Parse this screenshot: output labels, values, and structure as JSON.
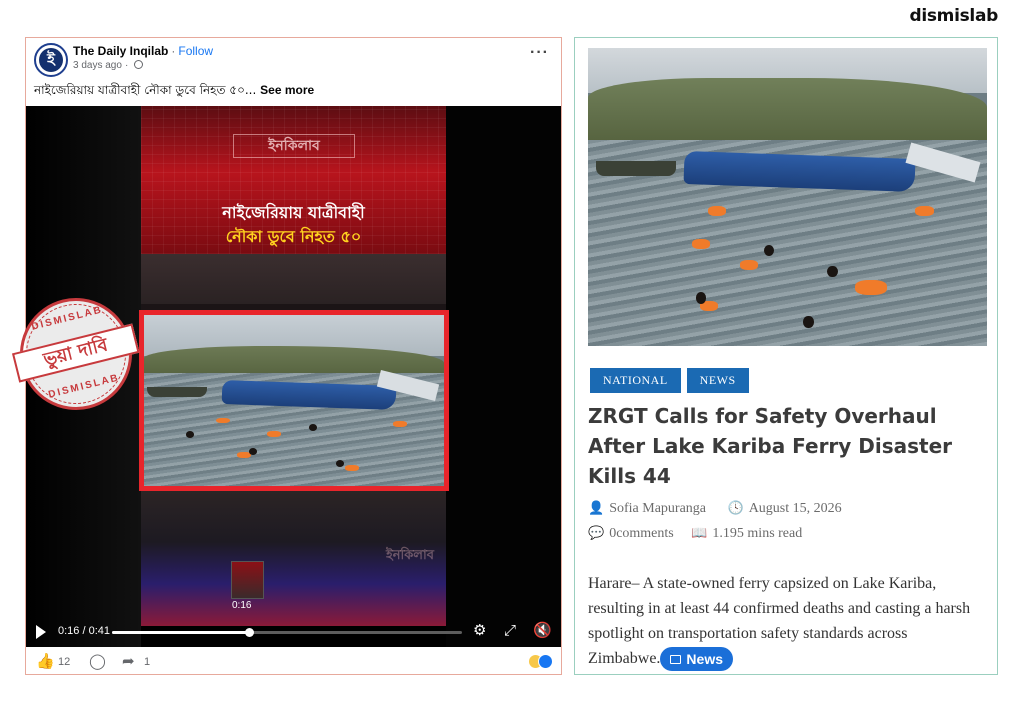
{
  "brand": "dismislab",
  "facebook_post": {
    "page_name": "The Daily Inqilab",
    "follow_label": "Follow",
    "time_ago": "3 days ago",
    "caption": "নাইজেরিয়ায় যাত্রীবাহী নৌকা ডুবে নিহত ৫০...",
    "see_more": "See more",
    "video": {
      "logo_text": "ইনকিলাব",
      "headline_line1": "নাইজেরিয়ায় যাত্রীবাহী",
      "headline_line2": "নৌকা ডুবে নিহত ৫০",
      "thumbnail_time": "0:16",
      "time_display": "0:16 / 0:41",
      "progress": 0.39
    },
    "likes_count": "12",
    "shares_count": "1"
  },
  "stamp": {
    "top_text": "DISMISLAB",
    "band_text": "ভুয়া দাবি",
    "bottom_text": "DISMISLAB",
    "color": "#c73a3d"
  },
  "article": {
    "tags": [
      "NATIONAL",
      "NEWS"
    ],
    "title": "ZRGT Calls for Safety Overhaul After Lake Kariba Ferry Disaster Kills 44",
    "author": "Sofia Mapuranga",
    "date": "August 15, 2026",
    "comments": "0comments",
    "read_time": "1.195 mins read",
    "excerpt": "Harare– A state-owned ferry capsized on Lake Kariba, resulting in at least 44 confirmed deaths and casting a harsh spotlight on transportation safety standards across Zimbabwe.",
    "news_pill": "News",
    "accent_color": "#1b6ab3"
  }
}
